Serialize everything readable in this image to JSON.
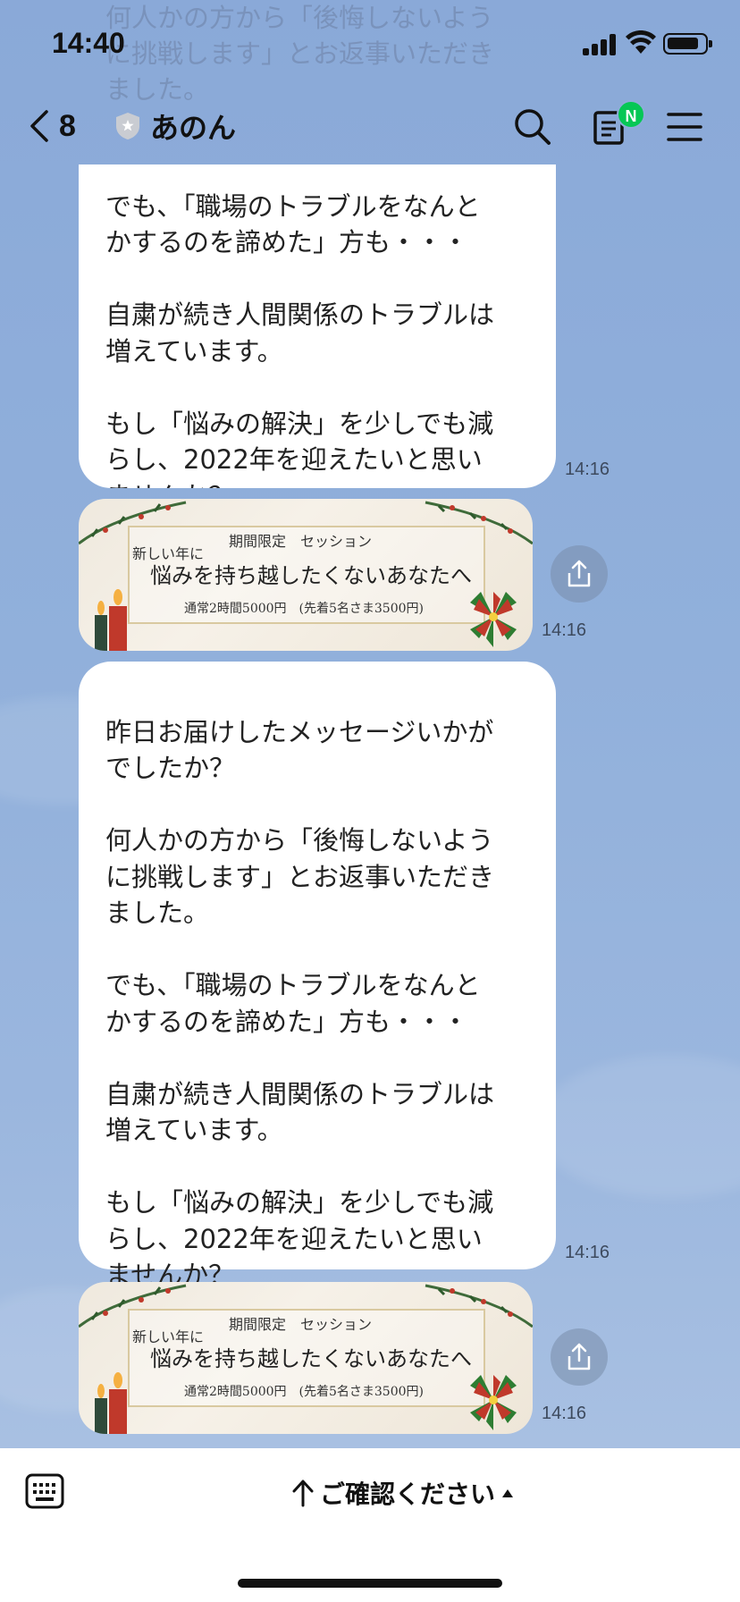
{
  "status_bar": {
    "time": "14:40"
  },
  "header": {
    "back_count": "8",
    "account_name": "あのん",
    "notes_badge": "N",
    "icons": [
      "chevron-left-icon",
      "shield-icon",
      "search-icon",
      "notes-icon",
      "menu-icon"
    ]
  },
  "messages": {
    "ghost_text": "何人かの方から「後悔しないよう\nに挑戦します」とお返事いただき\nました。",
    "msg1_text": "でも、「職場のトラブルをなんと\nかするのを諦めた」方も・・・\n\n自粛が続き人間関係のトラブルは\n増えています。\n\nもし「悩みの解決」を少しでも減\nらし、2022年を迎えたいと思い\nませんか？",
    "msg1_time": "14:16",
    "card1_time": "14:16",
    "msg2_text": "昨日お届けしたメッセージいかが\nでしたか？\n\n何人かの方から「後悔しないよう\nに挑戦します」とお返事いただき\nました。\n\nでも、「職場のトラブルをなんと\nかするのを諦めた」方も・・・\n\n自粛が続き人間関係のトラブルは\n増えています。\n\nもし「悩みの解決」を少しでも減\nらし、2022年を迎えたいと思い\nませんか？",
    "msg2_time": "14:16",
    "card2_time": "14:16"
  },
  "card": {
    "label": "期間限定　セッション",
    "sub": "新しい年に",
    "title": "悩みを持ち越したくないあなたへ",
    "price": "通常2時間5000円　(先着5名さま3500円)"
  },
  "bottom_bar": {
    "rich_menu_label": "ご確認ください"
  },
  "colors": {
    "chat_bg": "#8eacd9",
    "bubble": "#ffffff",
    "badge": "#06c755"
  }
}
